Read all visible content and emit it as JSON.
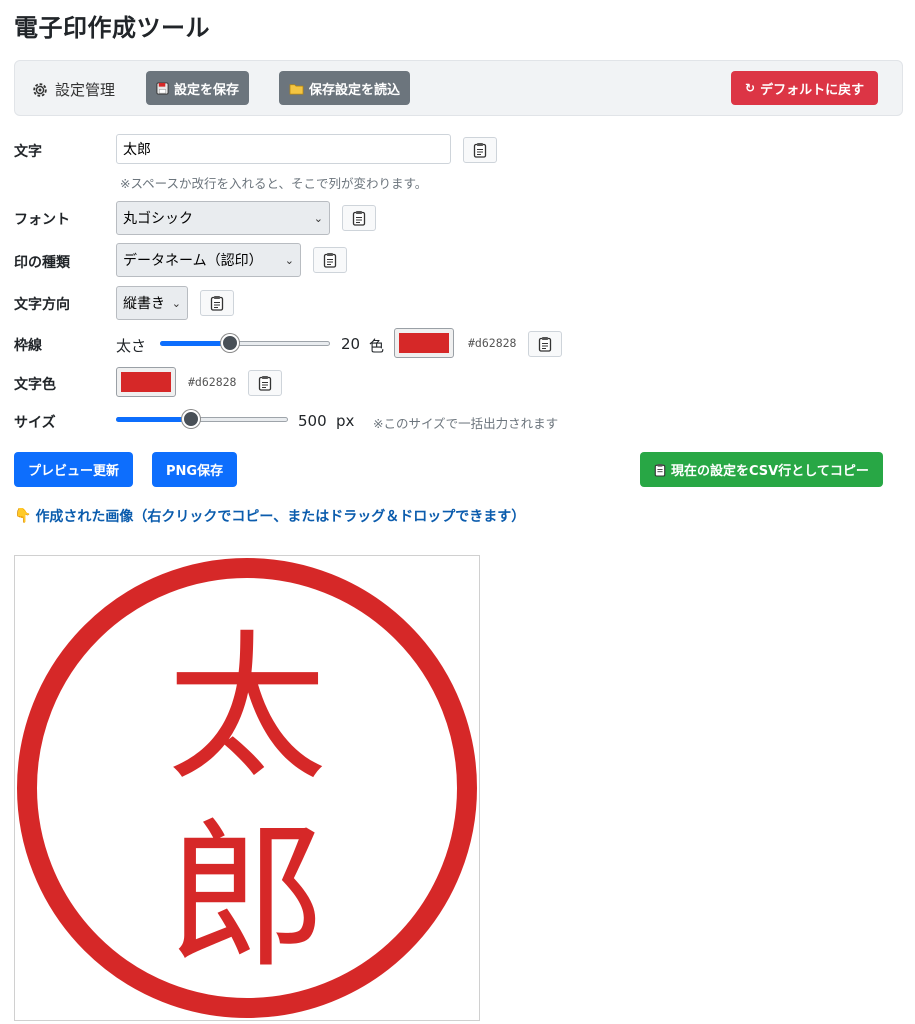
{
  "app": {
    "title": "電子印作成ツール"
  },
  "settings_bar": {
    "title": "設定管理",
    "save_label": "設定を保存",
    "load_label": "保存設定を読込",
    "reset_label": "デフォルトに戻す"
  },
  "form": {
    "text": {
      "label": "文字",
      "value": "太郎",
      "hint": "※スペースか改行を入れると、そこで列が変わります。"
    },
    "font": {
      "label": "フォント",
      "value": "丸ゴシック"
    },
    "stamp_type": {
      "label": "印の種類",
      "value": "データネーム（認印）"
    },
    "direction": {
      "label": "文字方向",
      "value": "縦書き"
    },
    "border": {
      "label": "枠線",
      "thickness_label": "太さ",
      "thickness": "20",
      "thickness_fraction": 0.4,
      "color_label": "色",
      "color": "#d62828",
      "color_text": "#d62828"
    },
    "text_color": {
      "label": "文字色",
      "color": "#d62828",
      "color_text": "#d62828"
    },
    "size": {
      "label": "サイズ",
      "value": "500",
      "unit": "px",
      "fraction": 0.43,
      "hint": "※このサイズで一括出力されます"
    }
  },
  "actions": {
    "preview_label": "プレビュー更新",
    "png_label": "PNG保存",
    "csv_label": "現在の設定をCSV行としてコピー"
  },
  "result": {
    "note": "作成された画像（右クリックでコピー、またはドラッグ＆ドロップできます）",
    "stamp_chars": [
      "太",
      "郎"
    ]
  },
  "icons": {
    "settings": "gear-icon",
    "save": "floppy-icon",
    "load": "folder-icon",
    "reset": "refresh-icon",
    "copy": "clipboard-icon",
    "note": "pointing-hand-icon"
  },
  "colors": {
    "stamp_red": "#d62828",
    "primary": "#0d6efd",
    "danger": "#dc3545",
    "success": "#28a745",
    "secondary": "#6c757d"
  }
}
